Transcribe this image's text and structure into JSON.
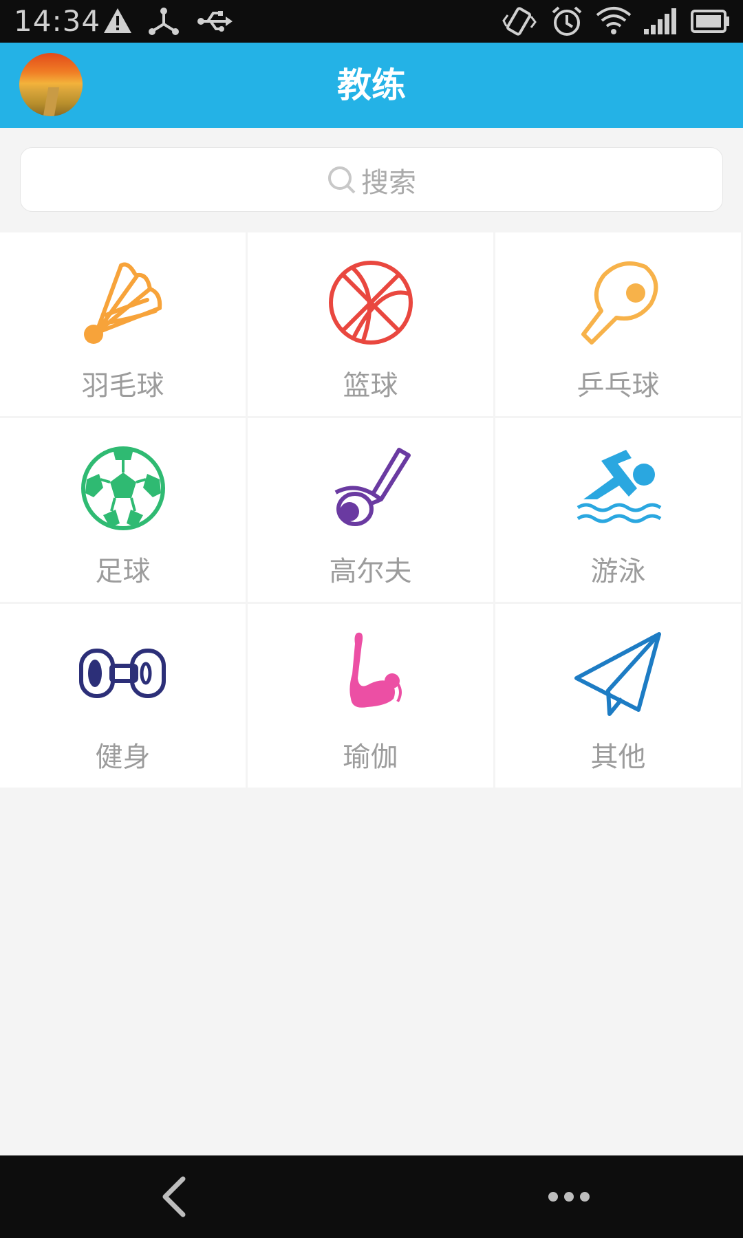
{
  "status_bar": {
    "time": "14:34",
    "icons": [
      "warning-icon",
      "share-hub-icon",
      "usb-icon",
      "vibrate-icon",
      "alarm-icon",
      "wifi-icon",
      "signal-icon",
      "battery-icon"
    ]
  },
  "header": {
    "title": "教练",
    "avatar": "avatar-image"
  },
  "search": {
    "placeholder": "搜索",
    "icon": "search-icon"
  },
  "categories": [
    {
      "label": "羽毛球",
      "icon": "badminton-icon",
      "color": "#f7a33a"
    },
    {
      "label": "篮球",
      "icon": "basketball-icon",
      "color": "#e9473f"
    },
    {
      "label": "乒乓球",
      "icon": "ping-pong-icon",
      "color": "#f7b24a"
    },
    {
      "label": "足球",
      "icon": "soccer-icon",
      "color": "#2fba72"
    },
    {
      "label": "高尔夫",
      "icon": "golf-icon",
      "color": "#6a3aa1"
    },
    {
      "label": "游泳",
      "icon": "swimming-icon",
      "color": "#2aa7e0"
    },
    {
      "label": "健身",
      "icon": "dumbbell-icon",
      "color": "#2c2f78"
    },
    {
      "label": "瑜伽",
      "icon": "yoga-icon",
      "color": "#ec4fa4"
    },
    {
      "label": "其他",
      "icon": "paper-plane-icon",
      "color": "#1d7cc4"
    }
  ],
  "nav_bar": {
    "icons": [
      "back-icon",
      "more-icon"
    ]
  },
  "colors": {
    "header_bg": "#24b2e6",
    "page_bg": "#f4f4f4",
    "label_text": "#9c9c9c"
  }
}
